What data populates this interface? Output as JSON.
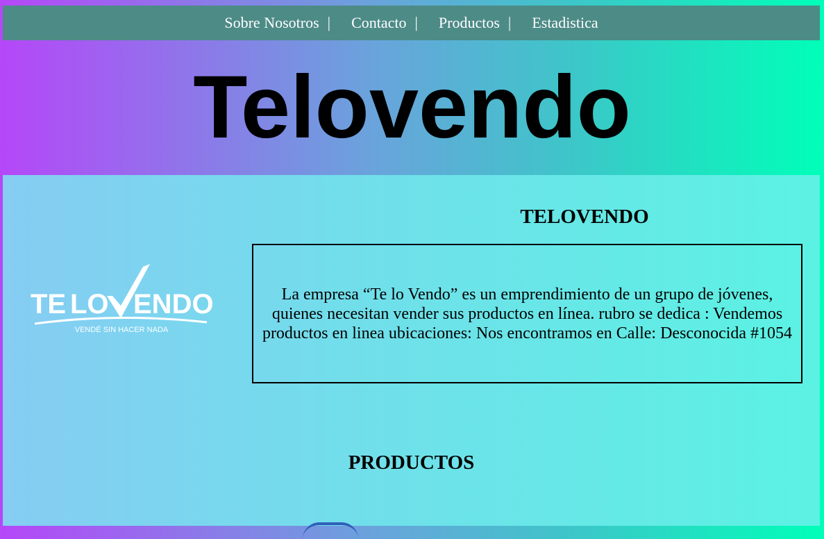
{
  "nav": {
    "items": [
      {
        "label": "Sobre Nosotros",
        "sep": "|"
      },
      {
        "label": "Contacto",
        "sep": "|"
      },
      {
        "label": "Productos",
        "sep": "|"
      },
      {
        "label": "Estadistica",
        "sep": ""
      }
    ]
  },
  "hero": {
    "title": "Telovendo"
  },
  "logo": {
    "text_te": "TE",
    "text_lo": "LO",
    "text_endo": "ENDO",
    "tagline": "VENDÉ SIN HACER NADA"
  },
  "company": {
    "heading": "TELOVENDO",
    "description": "La empresa “Te lo Vendo” es un emprendimiento de un grupo de jóvenes, quienes necesitan vender sus productos en línea. rubro se dedica : Vendemos productos en linea ubicaciones: Nos encontramos en Calle: Desconocida #1054"
  },
  "products": {
    "heading": "PRODUCTOS"
  },
  "colors": {
    "navbar": "#4d8b86",
    "text": "#000000",
    "nav_text": "#ffffff"
  }
}
